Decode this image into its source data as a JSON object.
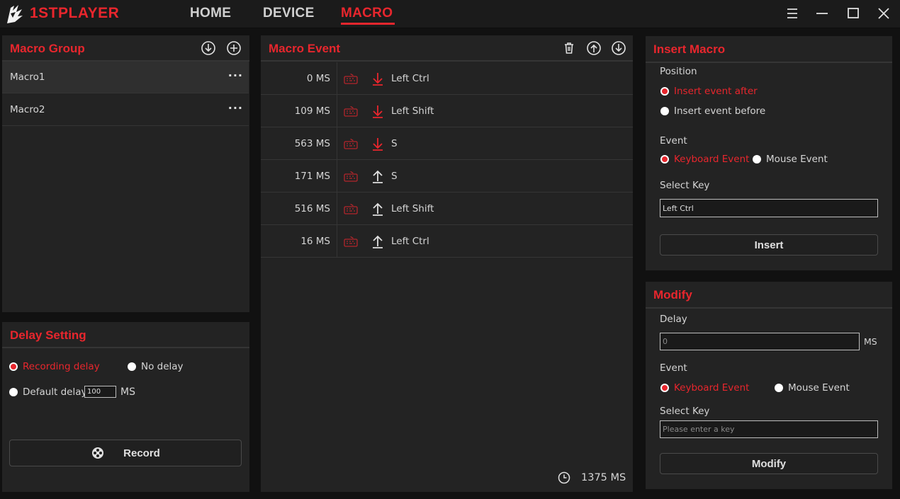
{
  "app": {
    "brand": "1STPLAYER",
    "accent_color": "#e8262d",
    "nav": [
      {
        "label": "HOME"
      },
      {
        "label": "DEVICE"
      },
      {
        "label": "MACRO",
        "active": true
      }
    ],
    "window_controls": [
      "menu-icon",
      "minimize-icon",
      "maximize-icon",
      "close-icon"
    ]
  },
  "macro_group": {
    "title": "Macro Group",
    "icons": [
      "import-icon",
      "add-icon"
    ],
    "items": [
      {
        "name": "Macro1",
        "menu": "···",
        "selected": true
      },
      {
        "name": "Macro2",
        "menu": "···",
        "selected": false
      }
    ]
  },
  "delay_setting": {
    "title": "Delay Setting",
    "options": {
      "recording": "Recording delay",
      "none": "No delay",
      "default": "Default delay"
    },
    "selected": "recording",
    "default_value": "100",
    "unit": "MS",
    "record_label": "Record"
  },
  "macro_event": {
    "title": "Macro Event",
    "icons": [
      "trash-icon",
      "move-up-icon",
      "move-down-icon"
    ],
    "events": [
      {
        "delay": "0 MS",
        "action": "down",
        "key": "Left Ctrl"
      },
      {
        "delay": "109 MS",
        "action": "down",
        "key": "Left Shift"
      },
      {
        "delay": "563 MS",
        "action": "down",
        "key": "S"
      },
      {
        "delay": "171 MS",
        "action": "up",
        "key": "S"
      },
      {
        "delay": "516 MS",
        "action": "up",
        "key": "Left Shift"
      },
      {
        "delay": "16 MS",
        "action": "up",
        "key": "Left Ctrl"
      }
    ],
    "total": "1375 MS"
  },
  "insert_macro": {
    "title": "Insert Macro",
    "position_label": "Position",
    "position_after": "Insert event after",
    "position_before": "Insert event before",
    "event_label": "Event",
    "event_keyboard": "Keyboard Event",
    "event_mouse": "Mouse Event",
    "select_key_label": "Select Key",
    "select_key_value": "Left Ctrl",
    "button_label": "Insert"
  },
  "modify": {
    "title": "Modify",
    "delay_label": "Delay",
    "delay_placeholder": "0",
    "delay_unit": "MS",
    "event_label": "Event",
    "event_keyboard": "Keyboard Event",
    "event_mouse": "Mouse Event",
    "select_key_label": "Select Key",
    "select_key_placeholder": "Please enter a key",
    "button_label": "Modify"
  }
}
